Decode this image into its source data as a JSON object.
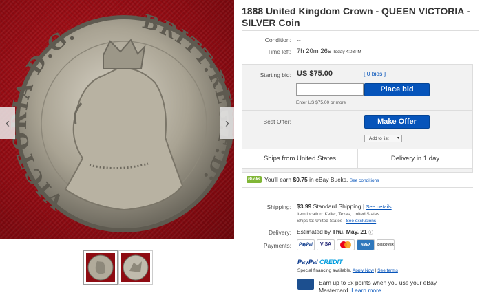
{
  "item": {
    "title": "1888 United Kingdom Crown - QUEEN VICTORIA - SILVER Coin",
    "legend_left": "VICTORIA D:G:",
    "legend_right": "BRITT:REG:F:D:"
  },
  "details": {
    "condition_label": "Condition:",
    "condition_value": "--",
    "time_left_label": "Time left:",
    "time_left_value": "7h 20m 26s",
    "time_left_end": "Today 4:03PM",
    "starting_bid_label": "Starting bid:",
    "starting_bid_value": "US $75.00",
    "bids_link": "[ 0 bids ]",
    "bid_hint": "Enter US $75.00 or more",
    "place_bid_button": "Place bid",
    "best_offer_label": "Best Offer:",
    "make_offer_button": "Make Offer",
    "add_to_list": "Add to list",
    "ships_from": "Ships from United States",
    "delivery_time": "Delivery in 1 day",
    "bucks_badge": "Bucks",
    "bucks_text_pre": "You'll earn ",
    "bucks_amount": "$0.75",
    "bucks_text_post": " in eBay Bucks.",
    "bucks_link": "See conditions"
  },
  "shipping": {
    "label": "Shipping:",
    "cost": "$3.99",
    "method": "Standard Shipping",
    "details_link": "See details",
    "item_location": "Item location:  Keller, Texas, United States",
    "ships_to": "Ships to:  United States",
    "exclusions_link": "See exclusions",
    "delivery_label": "Delivery:",
    "delivery_pre": "Estimated by ",
    "delivery_date": "Thu. May. 21",
    "payments_label": "Payments:",
    "payment_methods": [
      "PayPal",
      "VISA",
      "MC",
      "AMEX",
      "DISCOVER"
    ],
    "paypal_credit_1": "PayPal ",
    "paypal_credit_2": "CREDIT",
    "financing_text": "Special financing available.",
    "apply_now": "Apply Now",
    "see_terms": "See terms",
    "mastercard_line1": "Earn up to 5x points when you use your eBay",
    "mastercard_line2": "Mastercard.",
    "learn_more": "Learn more"
  },
  "colors": {
    "ebay_blue": "#0654ba",
    "bucks_green": "#80b636"
  },
  "icons": {
    "prev": "‹",
    "next": "›"
  }
}
